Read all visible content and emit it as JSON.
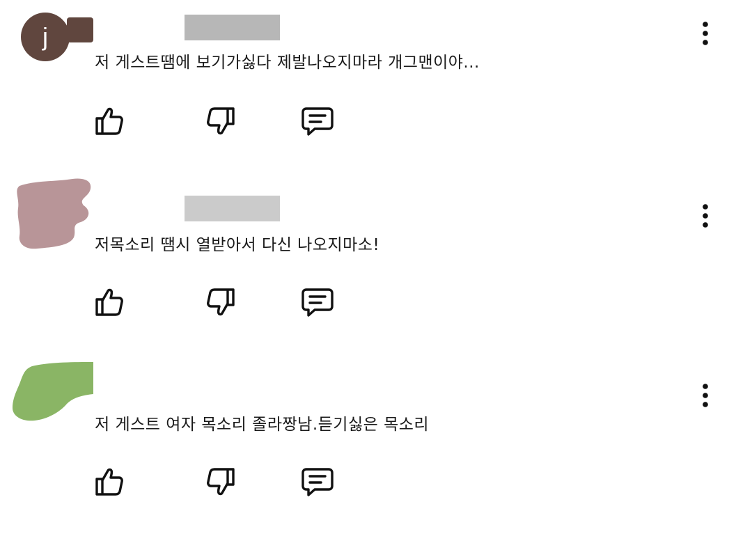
{
  "comments": [
    {
      "avatar_letter": "j",
      "avatar_color": "#60463e",
      "text": "저 게스트땜에 보기가싫다 제발나오지마라 개그맨이야..."
    },
    {
      "avatar_color": "#b89598",
      "text": "저목소리 땜시 열받아서 다신 나오지마소!"
    },
    {
      "avatar_color": "#8ab565",
      "text": "저 게스트 여자 목소리 졸라짱남.듣기싫은 목소리"
    }
  ],
  "icons": {
    "like": "thumbs-up-icon",
    "dislike": "thumbs-down-icon",
    "reply": "comment-icon",
    "more": "more-vert-icon"
  }
}
